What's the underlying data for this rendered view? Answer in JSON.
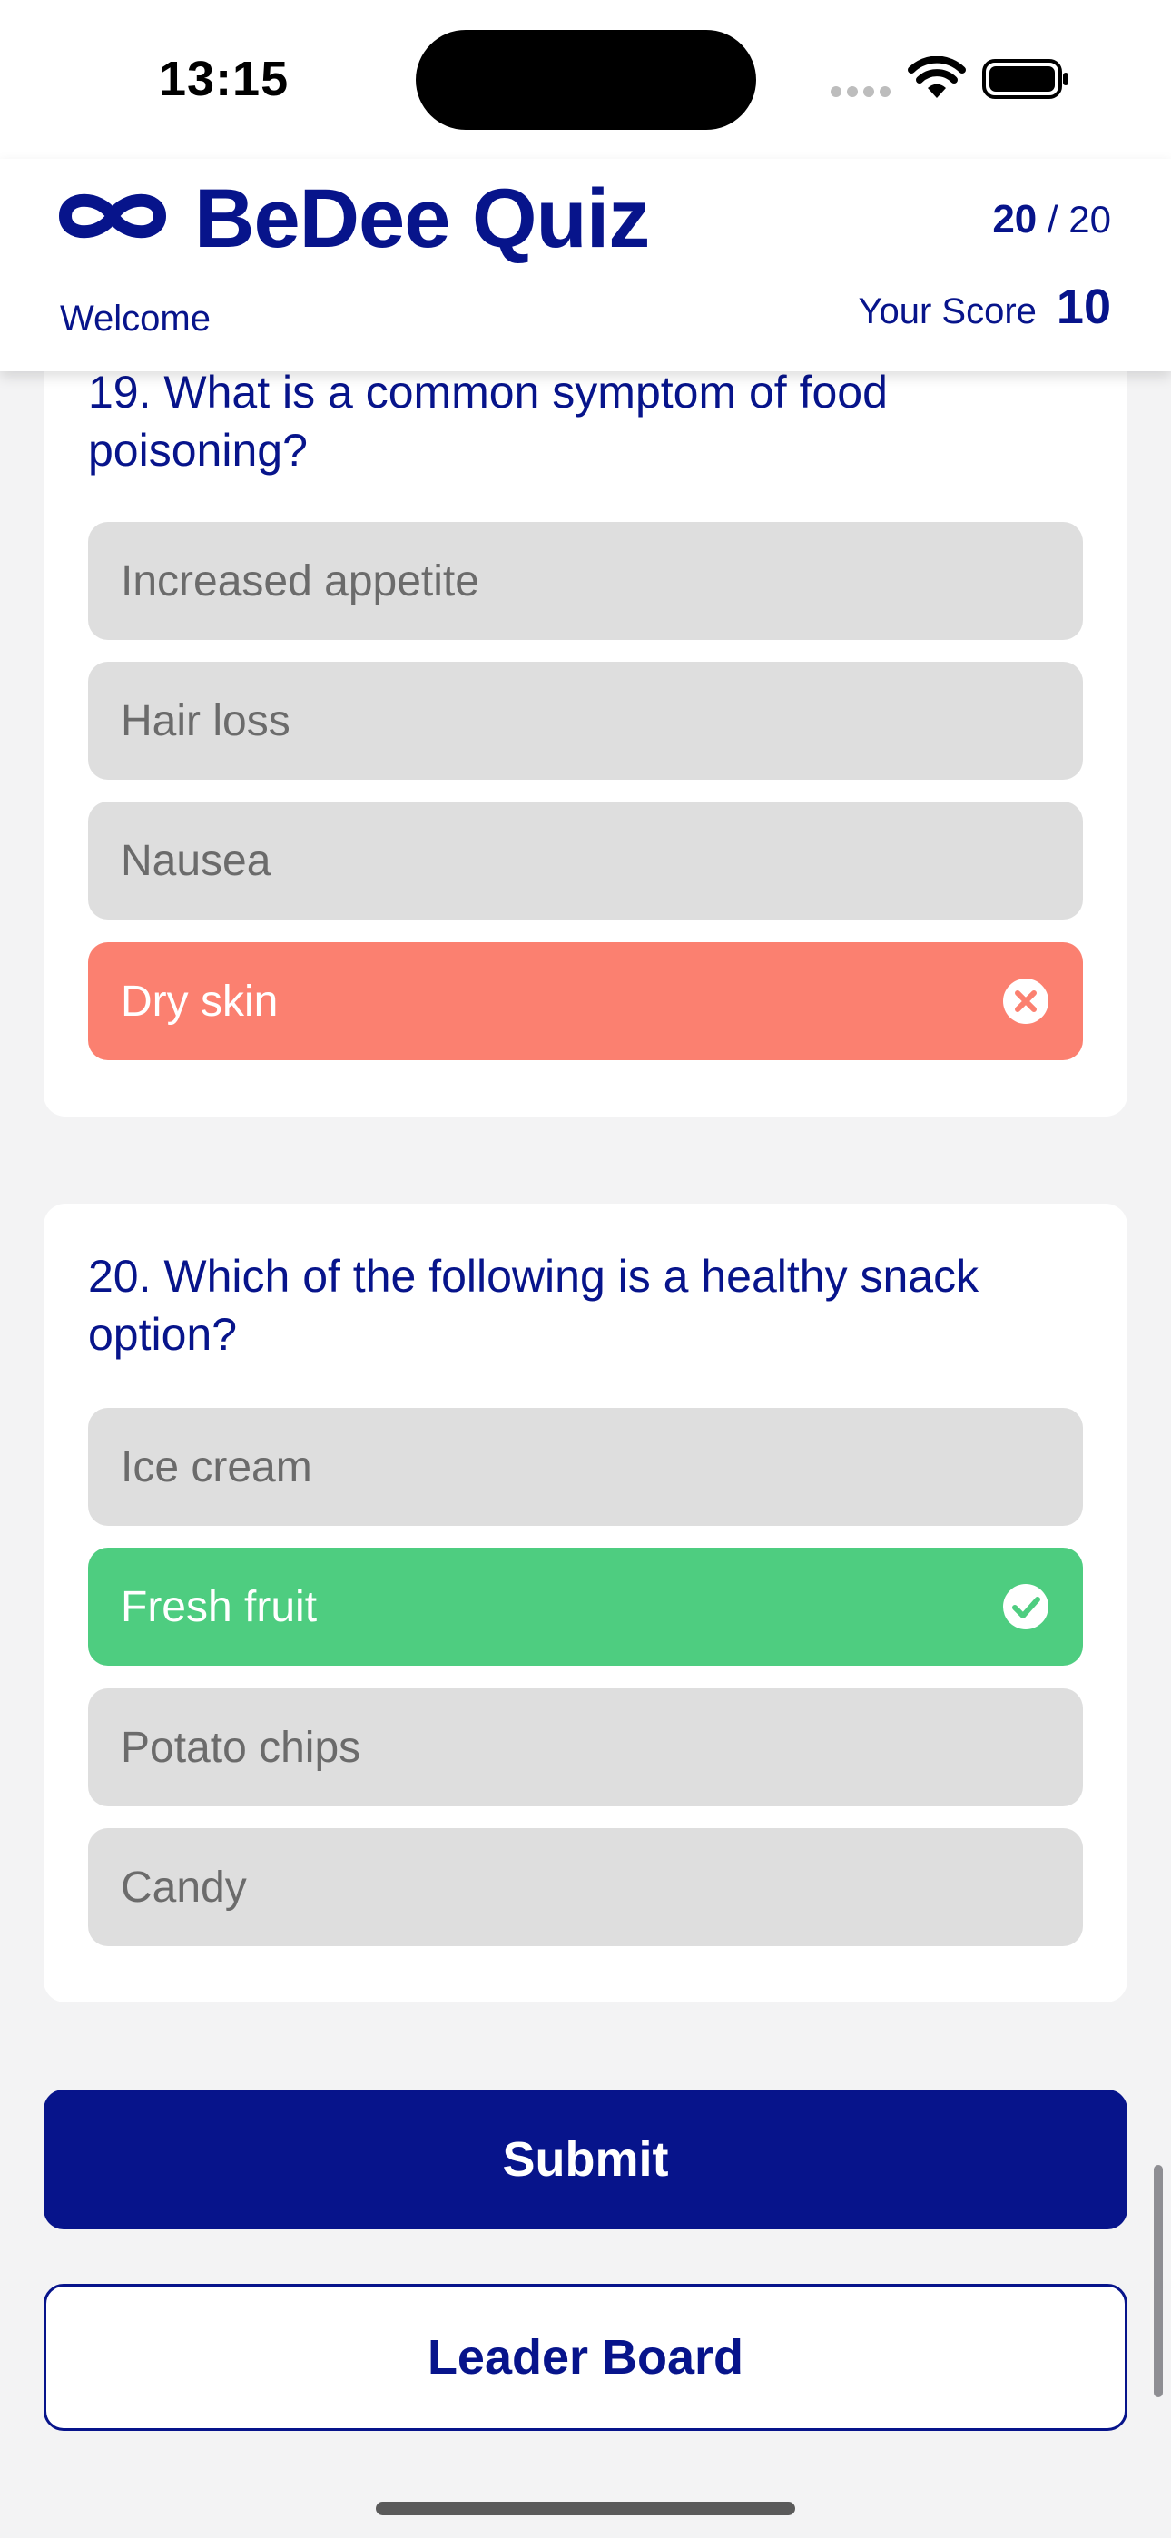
{
  "status_bar": {
    "time": "13:15"
  },
  "header": {
    "title": "BeDee Quiz",
    "welcome": "Welcome",
    "current_question": "20",
    "separator": " / ",
    "total_questions": "20",
    "score_label": "Your Score",
    "score_value": "10",
    "brand_color": "#07148b"
  },
  "questions": [
    {
      "text": "19. What is a common symptom of food poisoning?",
      "options": [
        {
          "label": "Increased appetite",
          "state": "neutral"
        },
        {
          "label": "Hair loss",
          "state": "neutral"
        },
        {
          "label": "Nausea",
          "state": "neutral"
        },
        {
          "label": "Dry skin",
          "state": "wrong"
        }
      ]
    },
    {
      "text": "20. Which of the following is a healthy snack option?",
      "options": [
        {
          "label": "Ice cream",
          "state": "neutral"
        },
        {
          "label": "Fresh fruit",
          "state": "correct"
        },
        {
          "label": "Potato chips",
          "state": "neutral"
        },
        {
          "label": "Candy",
          "state": "neutral"
        }
      ]
    }
  ],
  "colors": {
    "neutral": "#dedede",
    "wrong": "#fb8070",
    "correct": "#4ecd80"
  },
  "icons": {
    "wrong": "x-circle-icon",
    "correct": "check-circle-icon"
  },
  "buttons": {
    "submit": "Submit",
    "leader_board": "Leader Board"
  }
}
